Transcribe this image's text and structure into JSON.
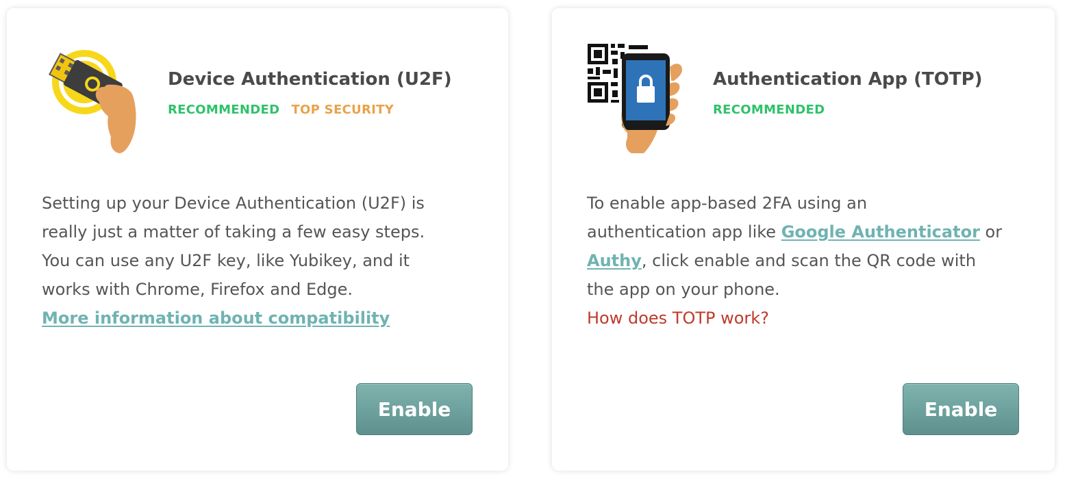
{
  "u2f": {
    "title": "Device Authentication (U2F)",
    "badges": [
      "RECOMMENDED",
      "TOP SECURITY"
    ],
    "body_lines": [
      "Setting up your Device Authentication (U2F) is",
      "really just a matter of taking a few easy steps.",
      "You can use any U2F key, like Yubikey, and it",
      "works with Chrome, Firefox and Edge."
    ],
    "link_text": "More information about compatibility",
    "enable_label": "Enable",
    "icon": "usb-key-hand-icon"
  },
  "totp": {
    "title": "Authentication App (TOTP)",
    "badges": [
      "RECOMMENDED"
    ],
    "body_part1": "To enable app-based 2FA using an",
    "body_part2": "authentication app like ",
    "link_google": "Google Authenticator",
    "body_part3": " or",
    "link_authy": "Authy",
    "body_part4": ", click enable and scan the QR code with",
    "body_part5": "the app on your phone.",
    "help_link": "How does TOTP work?",
    "enable_label": "Enable",
    "icon": "qr-phone-lock-icon"
  },
  "colors": {
    "title": "#4a4a4a",
    "body": "#555555",
    "recommended": "#2ec26a",
    "top_security": "#e9a24b",
    "link": "#6fb3b1",
    "help_link": "#c0392b",
    "button_top": "#7fb3ae",
    "button_bottom": "#5e918e",
    "button_text": "#ffffff"
  }
}
